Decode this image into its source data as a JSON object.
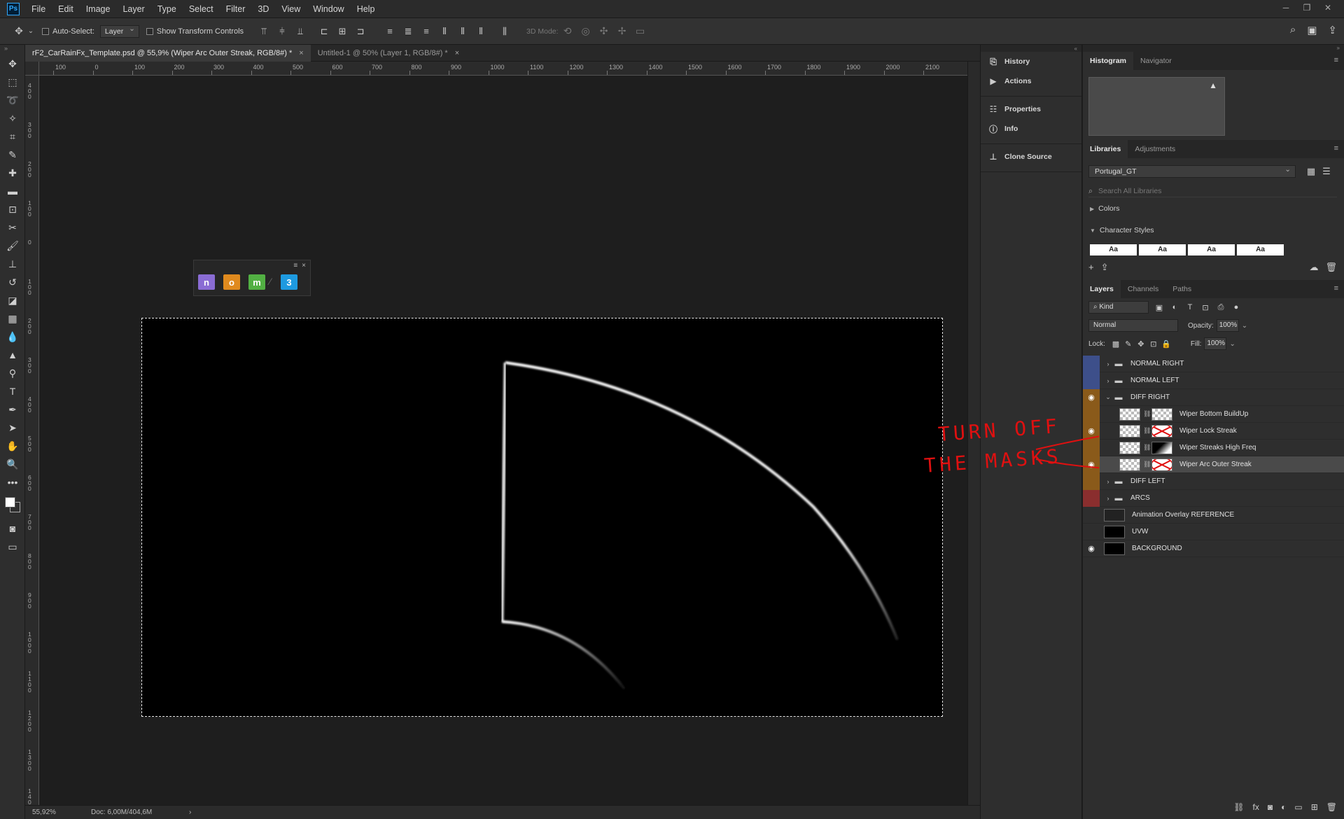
{
  "menubar": {
    "logo": "Ps",
    "items": [
      "File",
      "Edit",
      "Image",
      "Layer",
      "Type",
      "Select",
      "Filter",
      "3D",
      "View",
      "Window",
      "Help"
    ]
  },
  "options": {
    "auto_select_label": "Auto-Select:",
    "auto_select_value": "Layer",
    "transform_label": "Show Transform Controls",
    "mode_3d_label": "3D Mode:"
  },
  "doc_tabs": [
    {
      "title": "rF2_CarRainFx_Template.psd @ 55,9% (Wiper Arc Outer Streak, RGB/8#) *",
      "close": "×"
    },
    {
      "title": "Untitled-1 @ 50% (Layer 1, RGB/8#) *",
      "close": "×"
    }
  ],
  "ruler_top": [
    "100",
    "0",
    "100",
    "200",
    "300",
    "400",
    "500",
    "600",
    "700",
    "800",
    "900",
    "1000",
    "1100",
    "1200",
    "1300",
    "1400",
    "1500",
    "1600",
    "1700",
    "1800",
    "1900",
    "2000",
    "2100"
  ],
  "ruler_left": [
    "400",
    "300",
    "200",
    "100",
    "0",
    "100",
    "200",
    "300",
    "400",
    "500",
    "600",
    "700",
    "800",
    "900",
    "1000",
    "1100",
    "1200",
    "1300",
    "1400"
  ],
  "plugin": {
    "buttons": [
      {
        "label": "n",
        "color": "#8a6cd4"
      },
      {
        "label": "o",
        "color": "#e08a1e"
      },
      {
        "label": "m",
        "color": "#52b043"
      },
      {
        "label": "3",
        "color": "#1e9ae0"
      }
    ],
    "close": "×"
  },
  "statusbar": {
    "zoom": "55,92%",
    "doc": "Doc: 6,00M/404,6M",
    "arrow": "›"
  },
  "mini_dock": [
    {
      "label": "History",
      "icon": "history-icon"
    },
    {
      "label": "Actions",
      "icon": "play-icon"
    },
    {
      "label": "Properties",
      "icon": "properties-icon"
    },
    {
      "label": "Info",
      "icon": "info-icon"
    },
    {
      "label": "Clone Source",
      "icon": "clone-source-icon"
    }
  ],
  "histogram_panel": {
    "tabs": [
      "Histogram",
      "Navigator"
    ]
  },
  "libraries_panel": {
    "tabs": [
      "Libraries",
      "Adjustments"
    ],
    "library": "Portugal_GT",
    "search_placeholder": "Search All Libraries",
    "colors": "Colors",
    "char_styles": "Character Styles",
    "char_sample": "Aa"
  },
  "layers_panel": {
    "tabs": [
      "Layers",
      "Channels",
      "Paths"
    ],
    "kind": "Kind",
    "blend_mode": "Normal",
    "opacity_label": "Opacity:",
    "opacity_value": "100%",
    "lock_label": "Lock:",
    "fill_label": "Fill:",
    "fill_value": "100%",
    "layers": [
      {
        "name": "NORMAL RIGHT",
        "type": "group",
        "visible": false,
        "tag": "#3d4f8a"
      },
      {
        "name": "NORMAL LEFT",
        "type": "group",
        "visible": false,
        "tag": "#3d4f8a"
      },
      {
        "name": "DIFF RIGHT",
        "type": "group-open",
        "visible": true,
        "tag": "#8a5a1a"
      },
      {
        "name": "Wiper Bottom BuildUp",
        "type": "layer",
        "visible": false,
        "tag": "#8a5a1a",
        "thumb": "checker",
        "mask": "checker"
      },
      {
        "name": "Wiper Lock Streak",
        "type": "layer",
        "visible": true,
        "tag": "#8a5a1a",
        "thumb": "checker",
        "mask": "x"
      },
      {
        "name": "Wiper Streaks High Freq",
        "type": "layer",
        "visible": false,
        "tag": "#8a5a1a",
        "thumb": "checker",
        "mask": "dark"
      },
      {
        "name": "Wiper Arc Outer Streak",
        "type": "layer",
        "visible": true,
        "tag": "#8a5a1a",
        "thumb": "checker",
        "mask": "x",
        "selected": true
      },
      {
        "name": "DIFF LEFT",
        "type": "group",
        "visible": false,
        "tag": "#8a5a1a"
      },
      {
        "name": "ARCS",
        "type": "group",
        "visible": false,
        "tag": "#8a2e2e"
      },
      {
        "name": "Animation Overlay REFERENCE",
        "type": "plain",
        "visible": false,
        "tag": "",
        "thumb": "dark"
      },
      {
        "name": "UVW",
        "type": "plain",
        "visible": false,
        "tag": "",
        "thumb": "black"
      },
      {
        "name": "BACKGROUND",
        "type": "plain",
        "visible": true,
        "tag": "",
        "thumb": "black"
      }
    ]
  },
  "annotation": {
    "line1": "TURN OFF",
    "line2": "THE MASKS",
    "color": "#e01010"
  }
}
